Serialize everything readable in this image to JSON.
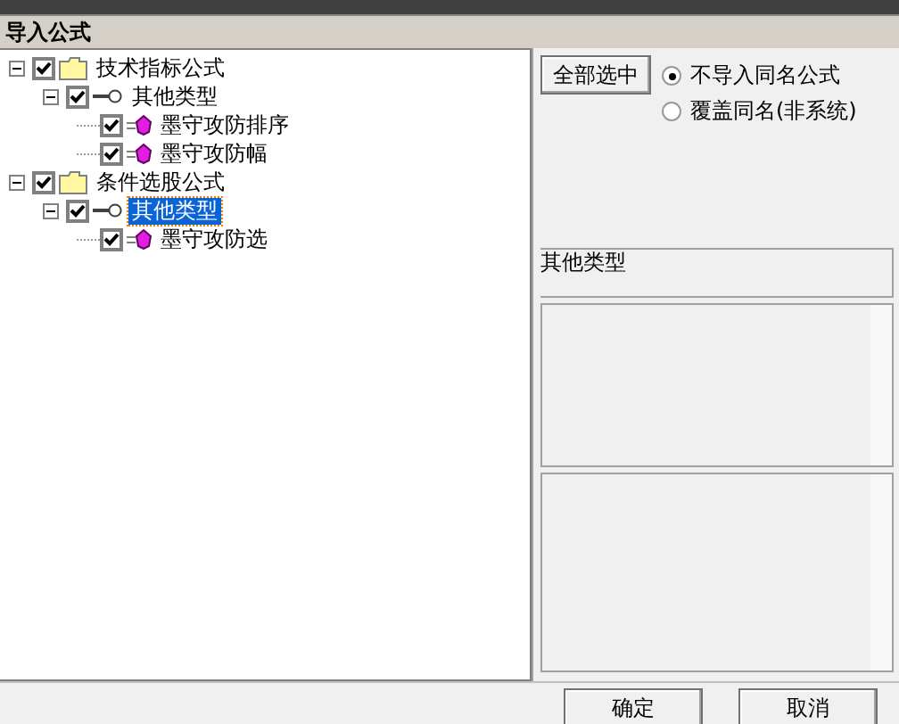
{
  "window": {
    "title": "导入公式"
  },
  "tree": [
    {
      "label": "技术指标公式",
      "kind": "folder",
      "checked": true,
      "expanded": true,
      "selected": false,
      "children": [
        {
          "label": "其他类型",
          "kind": "category",
          "checked": true,
          "expanded": true,
          "selected": false,
          "children": [
            {
              "label": "墨守攻防排序",
              "kind": "formula",
              "checked": true,
              "selected": false
            },
            {
              "label": "墨守攻防幅",
              "kind": "formula",
              "checked": true,
              "selected": false
            }
          ]
        }
      ]
    },
    {
      "label": "条件选股公式",
      "kind": "folder",
      "checked": true,
      "expanded": true,
      "selected": false,
      "children": [
        {
          "label": "其他类型",
          "kind": "category",
          "checked": true,
          "expanded": true,
          "selected": true,
          "children": [
            {
              "label": "墨守攻防选",
              "kind": "formula",
              "checked": true,
              "selected": false
            }
          ]
        }
      ]
    }
  ],
  "select_all_button": "全部选中",
  "options": [
    {
      "label": "不导入同名公式",
      "selected": true
    },
    {
      "label": "覆盖同名(非系统)",
      "selected": false
    }
  ],
  "category_field": "其他类型",
  "buttons": [
    "确定",
    "取消"
  ]
}
